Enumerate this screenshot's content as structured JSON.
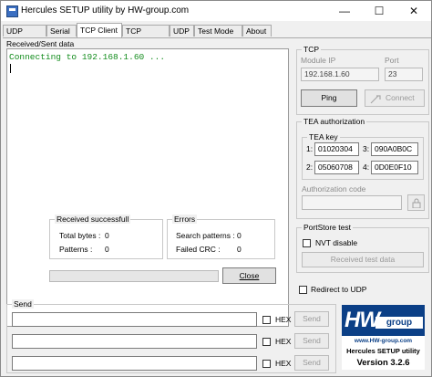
{
  "window": {
    "title": "Hercules SETUP utility by HW-group.com",
    "controls": {
      "minimize": "—",
      "maximize": "☐",
      "close": "✕"
    }
  },
  "tabs": [
    {
      "label": "UDP Setup"
    },
    {
      "label": "Serial"
    },
    {
      "label": "TCP Client",
      "active": true
    },
    {
      "label": "TCP Server"
    },
    {
      "label": "UDP"
    },
    {
      "label": "Test Mode"
    },
    {
      "label": "About"
    }
  ],
  "received_sent": {
    "label": "Received/Sent data",
    "text": "Connecting to 192.168.1.60 ..."
  },
  "stats": {
    "received_title": "Received successfull",
    "total_bytes_label": "Total bytes :",
    "total_bytes_value": "0",
    "patterns_label": "Patterns :",
    "patterns_value": "0",
    "errors_title": "Errors",
    "search_patterns_label": "Search patterns :",
    "search_patterns_value": "0",
    "failed_crc_label": "Failed CRC :",
    "failed_crc_value": "0",
    "close_label": "Close"
  },
  "tcp": {
    "title": "TCP",
    "module_ip_label": "Module IP",
    "module_ip_value": "192.168.1.60",
    "port_label": "Port",
    "port_value": "23",
    "ping_label": "Ping",
    "connect_label": "Connect"
  },
  "tea": {
    "title": "TEA authorization",
    "key_label": "TEA key",
    "keys": [
      {
        "index": "1:",
        "value": "01020304"
      },
      {
        "index": "2:",
        "value": "05060708"
      },
      {
        "index": "3:",
        "value": "090A0B0C"
      },
      {
        "index": "4:",
        "value": "0D0E0F10"
      }
    ],
    "auth_code_label": "Authorization code",
    "auth_code_value": ""
  },
  "portstore": {
    "title": "PortStore test",
    "nvt_label": "NVT disable",
    "received_test_label": "Received test data"
  },
  "redirect": {
    "label": "Redirect to UDP"
  },
  "send": {
    "title": "Send",
    "rows": [
      {
        "value": "",
        "hex_label": "HEX",
        "send_label": "Send"
      },
      {
        "value": "",
        "hex_label": "HEX",
        "send_label": "Send"
      },
      {
        "value": "",
        "hex_label": "HEX",
        "send_label": "Send"
      }
    ]
  },
  "logo": {
    "hw": "HW",
    "group": "group",
    "url": "www.HW-group.com",
    "product": "Hercules SETUP utility",
    "version": "Version  3.2.6"
  },
  "colors": {
    "terminal_text": "#128c1c",
    "logo_blue": "#0b3f86"
  }
}
